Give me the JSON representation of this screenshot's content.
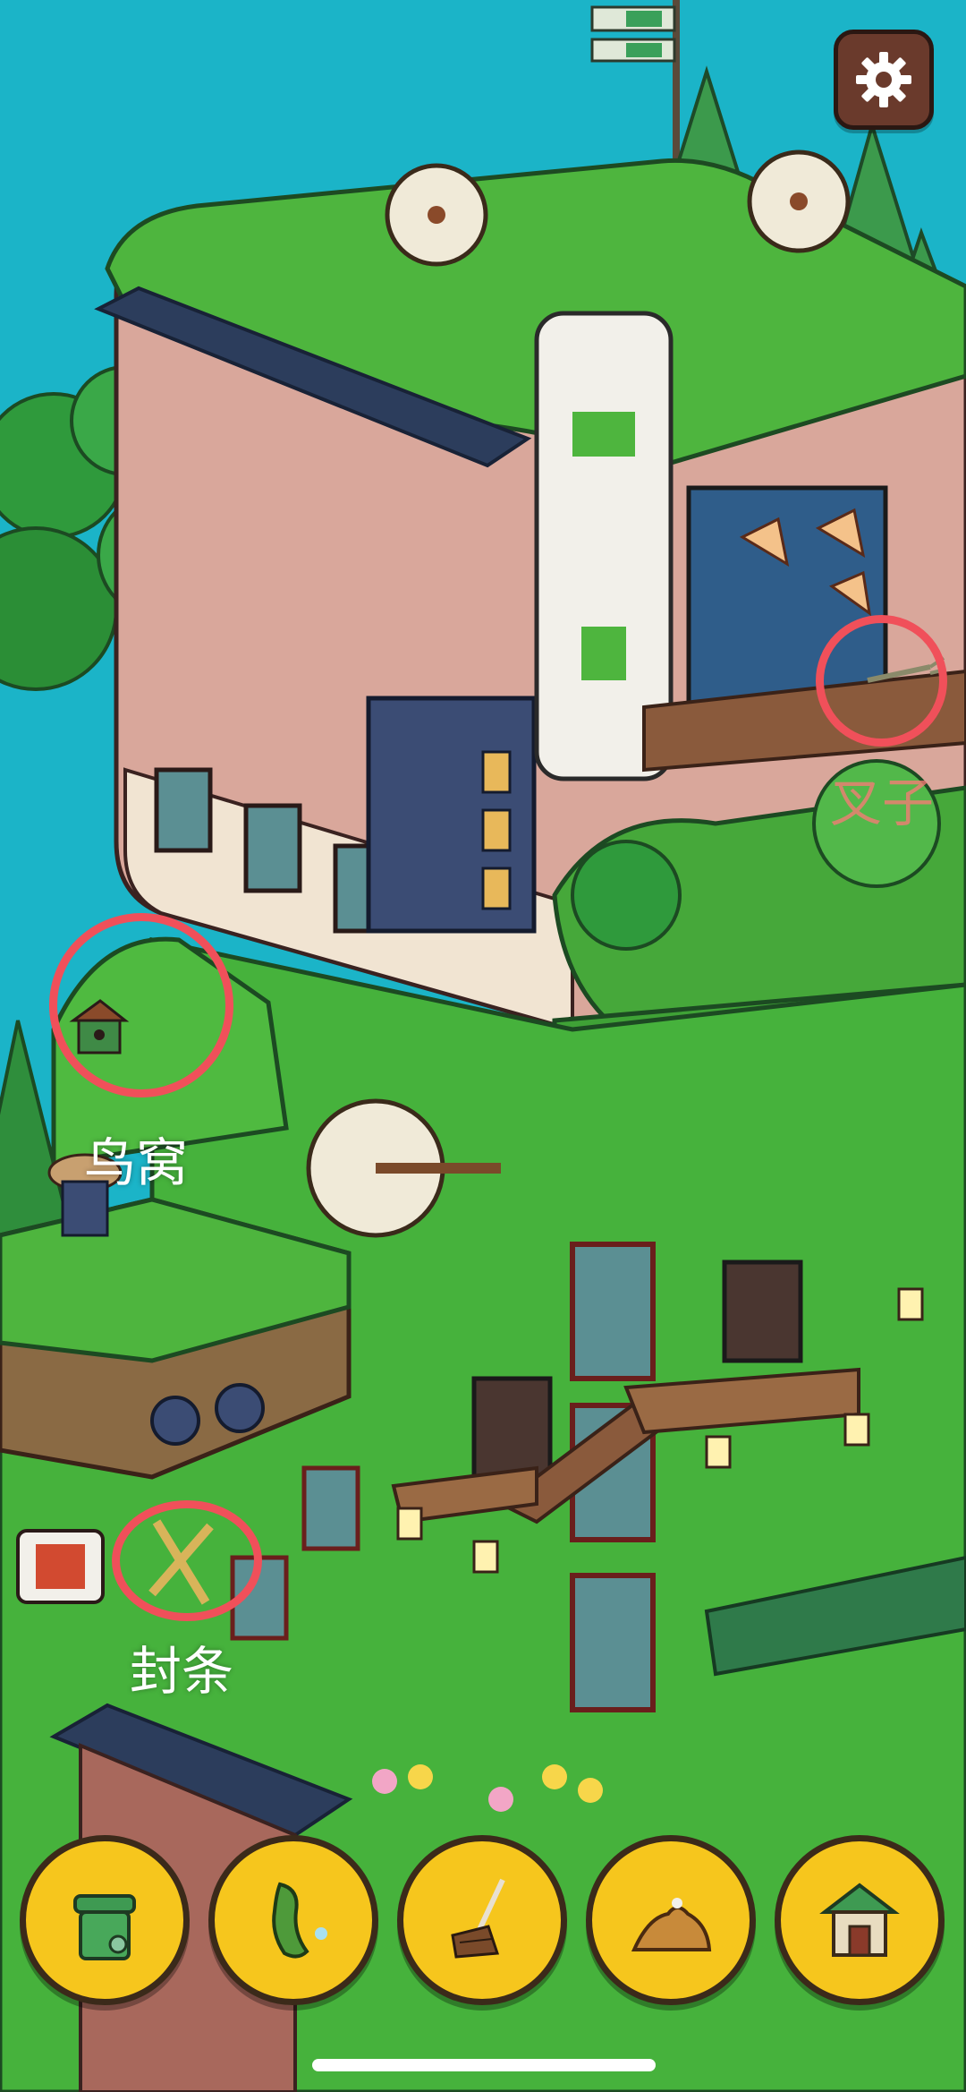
{
  "colors": {
    "sky": "#1bb4c8",
    "grass": "#3fae3a",
    "wall_pink": "#d9a79b",
    "wall_green": "#46b23c",
    "marker": "#f0505a",
    "tool_bg": "#f6c61d"
  },
  "settings": {
    "icon": "gear-icon"
  },
  "found_items": [
    {
      "id": "fork",
      "label": "叉子"
    },
    {
      "id": "birdhouse",
      "label": "鸟窝"
    },
    {
      "id": "seal",
      "label": "封条"
    }
  ],
  "toolbar": {
    "items": [
      {
        "id": "trash-bin",
        "icon": "trash-bin-icon"
      },
      {
        "id": "cucumber",
        "icon": "cucumber-icon"
      },
      {
        "id": "rake",
        "icon": "rake-icon"
      },
      {
        "id": "dirt-pile",
        "icon": "dirt-pile-icon"
      },
      {
        "id": "birdhouse",
        "icon": "birdhouse-icon"
      }
    ]
  }
}
